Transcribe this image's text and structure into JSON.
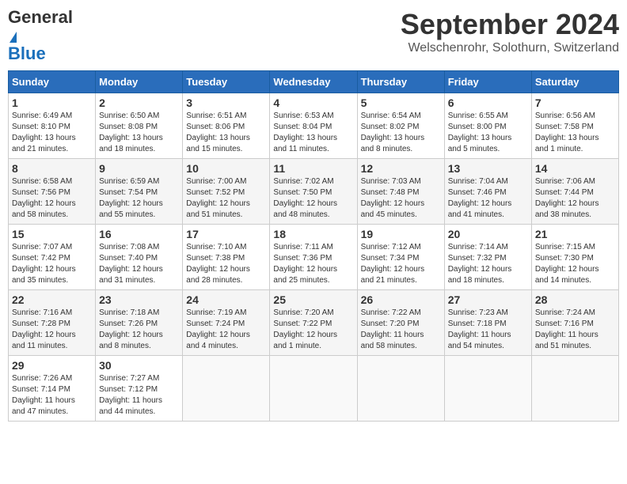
{
  "logo": {
    "general": "General",
    "blue": "Blue"
  },
  "title": {
    "month": "September 2024",
    "location": "Welschenrohr, Solothurn, Switzerland"
  },
  "headers": [
    "Sunday",
    "Monday",
    "Tuesday",
    "Wednesday",
    "Thursday",
    "Friday",
    "Saturday"
  ],
  "weeks": [
    [
      {
        "day": "1",
        "text": "Sunrise: 6:49 AM\nSunset: 8:10 PM\nDaylight: 13 hours\nand 21 minutes."
      },
      {
        "day": "2",
        "text": "Sunrise: 6:50 AM\nSunset: 8:08 PM\nDaylight: 13 hours\nand 18 minutes."
      },
      {
        "day": "3",
        "text": "Sunrise: 6:51 AM\nSunset: 8:06 PM\nDaylight: 13 hours\nand 15 minutes."
      },
      {
        "day": "4",
        "text": "Sunrise: 6:53 AM\nSunset: 8:04 PM\nDaylight: 13 hours\nand 11 minutes."
      },
      {
        "day": "5",
        "text": "Sunrise: 6:54 AM\nSunset: 8:02 PM\nDaylight: 13 hours\nand 8 minutes."
      },
      {
        "day": "6",
        "text": "Sunrise: 6:55 AM\nSunset: 8:00 PM\nDaylight: 13 hours\nand 5 minutes."
      },
      {
        "day": "7",
        "text": "Sunrise: 6:56 AM\nSunset: 7:58 PM\nDaylight: 13 hours\nand 1 minute."
      }
    ],
    [
      {
        "day": "8",
        "text": "Sunrise: 6:58 AM\nSunset: 7:56 PM\nDaylight: 12 hours\nand 58 minutes."
      },
      {
        "day": "9",
        "text": "Sunrise: 6:59 AM\nSunset: 7:54 PM\nDaylight: 12 hours\nand 55 minutes."
      },
      {
        "day": "10",
        "text": "Sunrise: 7:00 AM\nSunset: 7:52 PM\nDaylight: 12 hours\nand 51 minutes."
      },
      {
        "day": "11",
        "text": "Sunrise: 7:02 AM\nSunset: 7:50 PM\nDaylight: 12 hours\nand 48 minutes."
      },
      {
        "day": "12",
        "text": "Sunrise: 7:03 AM\nSunset: 7:48 PM\nDaylight: 12 hours\nand 45 minutes."
      },
      {
        "day": "13",
        "text": "Sunrise: 7:04 AM\nSunset: 7:46 PM\nDaylight: 12 hours\nand 41 minutes."
      },
      {
        "day": "14",
        "text": "Sunrise: 7:06 AM\nSunset: 7:44 PM\nDaylight: 12 hours\nand 38 minutes."
      }
    ],
    [
      {
        "day": "15",
        "text": "Sunrise: 7:07 AM\nSunset: 7:42 PM\nDaylight: 12 hours\nand 35 minutes."
      },
      {
        "day": "16",
        "text": "Sunrise: 7:08 AM\nSunset: 7:40 PM\nDaylight: 12 hours\nand 31 minutes."
      },
      {
        "day": "17",
        "text": "Sunrise: 7:10 AM\nSunset: 7:38 PM\nDaylight: 12 hours\nand 28 minutes."
      },
      {
        "day": "18",
        "text": "Sunrise: 7:11 AM\nSunset: 7:36 PM\nDaylight: 12 hours\nand 25 minutes."
      },
      {
        "day": "19",
        "text": "Sunrise: 7:12 AM\nSunset: 7:34 PM\nDaylight: 12 hours\nand 21 minutes."
      },
      {
        "day": "20",
        "text": "Sunrise: 7:14 AM\nSunset: 7:32 PM\nDaylight: 12 hours\nand 18 minutes."
      },
      {
        "day": "21",
        "text": "Sunrise: 7:15 AM\nSunset: 7:30 PM\nDaylight: 12 hours\nand 14 minutes."
      }
    ],
    [
      {
        "day": "22",
        "text": "Sunrise: 7:16 AM\nSunset: 7:28 PM\nDaylight: 12 hours\nand 11 minutes."
      },
      {
        "day": "23",
        "text": "Sunrise: 7:18 AM\nSunset: 7:26 PM\nDaylight: 12 hours\nand 8 minutes."
      },
      {
        "day": "24",
        "text": "Sunrise: 7:19 AM\nSunset: 7:24 PM\nDaylight: 12 hours\nand 4 minutes."
      },
      {
        "day": "25",
        "text": "Sunrise: 7:20 AM\nSunset: 7:22 PM\nDaylight: 12 hours\nand 1 minute."
      },
      {
        "day": "26",
        "text": "Sunrise: 7:22 AM\nSunset: 7:20 PM\nDaylight: 11 hours\nand 58 minutes."
      },
      {
        "day": "27",
        "text": "Sunrise: 7:23 AM\nSunset: 7:18 PM\nDaylight: 11 hours\nand 54 minutes."
      },
      {
        "day": "28",
        "text": "Sunrise: 7:24 AM\nSunset: 7:16 PM\nDaylight: 11 hours\nand 51 minutes."
      }
    ],
    [
      {
        "day": "29",
        "text": "Sunrise: 7:26 AM\nSunset: 7:14 PM\nDaylight: 11 hours\nand 47 minutes."
      },
      {
        "day": "30",
        "text": "Sunrise: 7:27 AM\nSunset: 7:12 PM\nDaylight: 11 hours\nand 44 minutes."
      },
      {
        "day": "",
        "text": ""
      },
      {
        "day": "",
        "text": ""
      },
      {
        "day": "",
        "text": ""
      },
      {
        "day": "",
        "text": ""
      },
      {
        "day": "",
        "text": ""
      }
    ]
  ]
}
